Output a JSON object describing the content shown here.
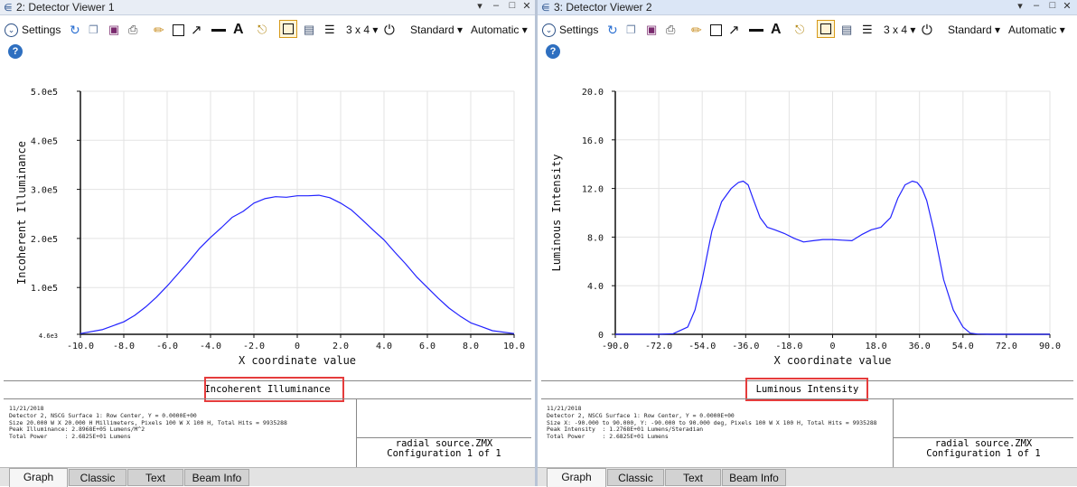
{
  "colors": {
    "curve": "#2222ff",
    "highlight": "#e53c3c"
  },
  "viewers": [
    {
      "title": "2: Detector Viewer 1",
      "toolbar": {
        "settings": "Settings",
        "layout": "3 x 4 ▾",
        "standard": "Standard ▾",
        "automatic": "Automatic ▾"
      },
      "plot_title": "Incoherent Illuminance",
      "details": "11/21/2018\nDetector 2, NSCG Surface 1: Row Center, Y = 0.0000E+00\nSize 20.000 W X 20.000 H Millimeters, Pixels 100 W X 100 H, Total Hits = 9935288\nPeak Illuminance: 2.8968E+05 Lumens/M^2\nTotal Power     : 2.6825E+01 Lumens",
      "file": "radial source.ZMX",
      "config": "Configuration 1 of 1",
      "tabs": [
        "Graph",
        "Classic",
        "Text",
        "Beam Info"
      ],
      "active_tab": 0
    },
    {
      "title": "3: Detector Viewer 2",
      "toolbar": {
        "settings": "Settings",
        "layout": "3 x 4 ▾",
        "standard": "Standard ▾",
        "automatic": "Automatic ▾"
      },
      "plot_title": "Luminous Intensity",
      "details": "11/21/2018\nDetector 2, NSCG Surface 1: Row Center, Y = 0.0000E+00\nSize X: -90.000 to 90.000, Y: -90.000 to 90.000 deg, Pixels 100 W X 100 H, Total Hits = 9935288\nPeak Intensity  : 1.2768E+01 Lumens/Steradian\nTotal Power     : 2.6825E+01 Lumens",
      "file": "radial source.ZMX",
      "config": "Configuration 1 of 1",
      "tabs": [
        "Graph",
        "Classic",
        "Text",
        "Beam Info"
      ],
      "active_tab": 0
    }
  ],
  "chart_data": [
    {
      "type": "line",
      "xlabel": "X coordinate value",
      "ylabel": "Incoherent Illuminance",
      "xlim": [
        -10,
        10
      ],
      "ylim": [
        4600.0,
        500000.0
      ],
      "xticks": [
        "-10.0",
        "-8.0",
        "-6.0",
        "-4.0",
        "-2.0",
        "0",
        "2.0",
        "4.0",
        "6.0",
        "8.0",
        "10.0"
      ],
      "yticks": [
        "4.6e3",
        "1.0e5",
        "2.0e5",
        "3.0e5",
        "4.0e5",
        "5.0e5"
      ],
      "ytick_values": [
        4600,
        100000,
        200000,
        300000,
        400000,
        500000
      ],
      "grid": true,
      "series": [
        {
          "x": [
            -10,
            -9,
            -8,
            -7.5,
            -7,
            -6.5,
            -6,
            -5.5,
            -5,
            -4.5,
            -4,
            -3.5,
            -3,
            -2.5,
            -2,
            -1.5,
            -1,
            -0.5,
            0,
            0.5,
            1,
            1.5,
            2,
            2.5,
            3,
            3.5,
            4,
            4.5,
            5,
            5.5,
            6,
            6.5,
            7,
            7.5,
            8,
            8.5,
            9,
            10
          ],
          "y": [
            6000,
            14000,
            30000,
            43000,
            60000,
            80000,
            103000,
            128000,
            153000,
            180000,
            202000,
            222000,
            243000,
            255000,
            272000,
            281000,
            285000,
            284000,
            287000,
            287000,
            288000,
            283000,
            272000,
            258000,
            238000,
            217000,
            197000,
            172000,
            148000,
            122000,
            100000,
            78000,
            58000,
            42000,
            28000,
            20000,
            12000,
            6000
          ]
        }
      ]
    },
    {
      "type": "line",
      "xlabel": "X coordinate value",
      "ylabel": "Luminous Intensity",
      "xlim": [
        -90,
        90
      ],
      "ylim": [
        0,
        20
      ],
      "xticks": [
        "-90.0",
        "-72.0",
        "-54.0",
        "-36.0",
        "-18.0",
        "0",
        "18.0",
        "36.0",
        "54.0",
        "72.0",
        "90.0"
      ],
      "yticks": [
        "0",
        "4.0",
        "8.0",
        "12.0",
        "16.0",
        "20.0"
      ],
      "ytick_values": [
        0,
        4,
        8,
        12,
        16,
        20
      ],
      "grid": true,
      "series": [
        {
          "x": [
            -90,
            -72,
            -66,
            -60,
            -57,
            -54,
            -50,
            -46,
            -42,
            -39,
            -37,
            -35,
            -33,
            -30,
            -27,
            -24,
            -20,
            -16,
            -12,
            -8,
            -4,
            0,
            4,
            8,
            12,
            16,
            20,
            24,
            27,
            30,
            33,
            35,
            37,
            39,
            42,
            46,
            50,
            54,
            57,
            60,
            66,
            72,
            90
          ],
          "y": [
            0,
            0,
            0.05,
            0.6,
            2.0,
            4.5,
            8.5,
            10.9,
            12.0,
            12.5,
            12.6,
            12.3,
            11.2,
            9.6,
            8.8,
            8.6,
            8.3,
            7.9,
            7.6,
            7.7,
            7.8,
            7.8,
            7.75,
            7.7,
            8.2,
            8.6,
            8.8,
            9.6,
            11.2,
            12.3,
            12.6,
            12.5,
            12.0,
            11.0,
            8.5,
            4.5,
            2.0,
            0.6,
            0.1,
            0.02,
            0,
            0,
            0
          ]
        }
      ]
    }
  ]
}
